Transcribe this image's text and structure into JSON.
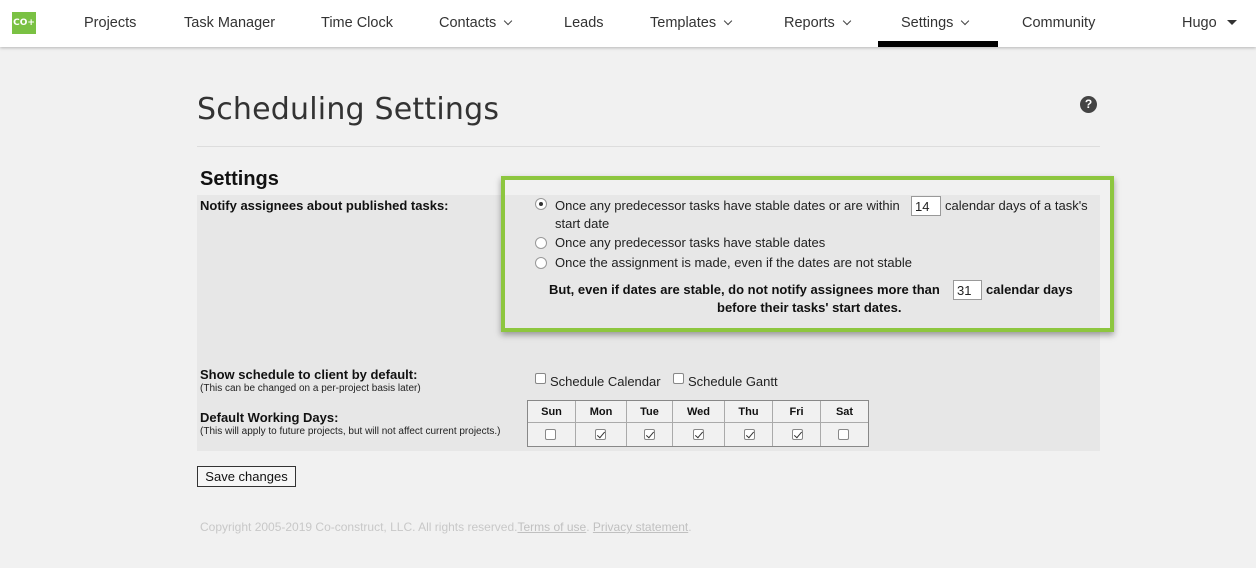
{
  "nav": {
    "logo": "CO+",
    "items": [
      "Projects",
      "Task Manager",
      "Time Clock",
      "Contacts",
      "Leads",
      "Templates",
      "Reports",
      "Settings",
      "Community"
    ],
    "user": "Hugo",
    "active": "Settings",
    "accent_color": "#000000"
  },
  "page": {
    "title": "Scheduling Settings",
    "help_icon": "question-circle-icon",
    "section_title": "Settings"
  },
  "notify": {
    "label": "Notify assignees about published tasks:",
    "option1_before": "Once any predecessor tasks have stable dates or are within",
    "option1_days": "14",
    "option1_after": "calendar days of a task's",
    "option1_line2": "start date",
    "option2": "Once any predecessor tasks have stable dates",
    "option3": "Once the assignment is made, even if the dates are not stable",
    "limit_before": "But, even if dates are stable, do not notify assignees more than",
    "limit_days": "31",
    "limit_after": "calendar days",
    "limit_line2": "before their tasks' start dates.",
    "selected": 1,
    "highlight_color": "#8dc63f"
  },
  "show_schedule": {
    "label": "Show schedule to client by default:",
    "sublabel": "(This can be changed on a per-project basis later)",
    "calendar_label": "Schedule Calendar",
    "gantt_label": "Schedule Gantt",
    "calendar_checked": false,
    "gantt_checked": false
  },
  "working_days": {
    "label": "Default Working Days:",
    "sublabel": "(This will apply to future projects, but will not affect current projects.)",
    "days": [
      {
        "name": "Sun",
        "checked": false
      },
      {
        "name": "Mon",
        "checked": true
      },
      {
        "name": "Tue",
        "checked": true
      },
      {
        "name": "Wed",
        "checked": true
      },
      {
        "name": "Thu",
        "checked": true
      },
      {
        "name": "Fri",
        "checked": true
      },
      {
        "name": "Sat",
        "checked": false
      }
    ]
  },
  "actions": {
    "save_label": "Save changes"
  },
  "footer": {
    "copyright": "Copyright 2005-2019 Co-construct, LLC. All rights reserved.",
    "terms": "Terms of use",
    "sep": ".",
    "privacy": "Privacy statement",
    "end": "."
  }
}
